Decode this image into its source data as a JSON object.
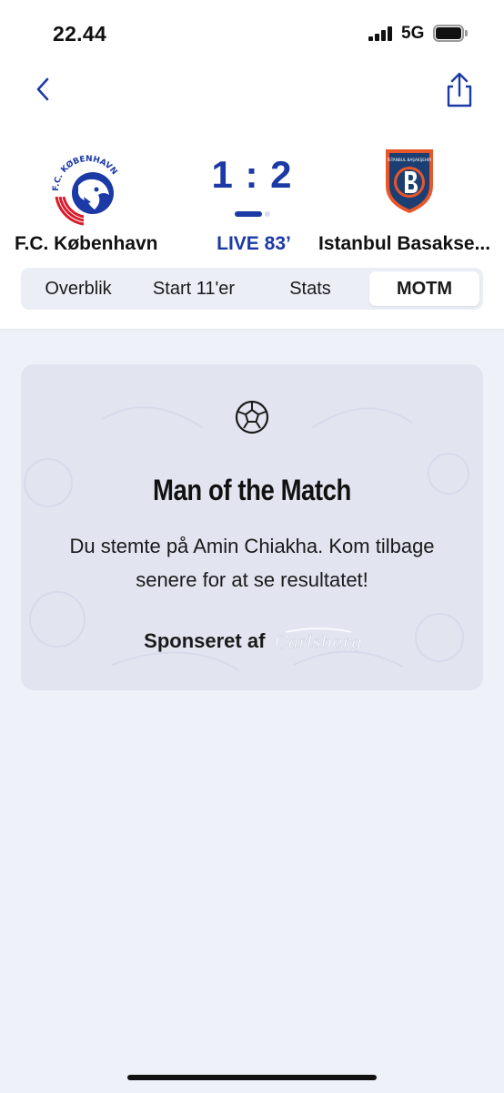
{
  "status_bar": {
    "time": "22.44",
    "network": "5G"
  },
  "nav": {
    "back_icon": "chevron-left-icon",
    "share_icon": "share-icon"
  },
  "match": {
    "home_team": "F.C. København",
    "away_team": "Istanbul Basakse...",
    "score": "1 : 2",
    "status": "LIVE 83’",
    "home_logo_text": "F.C. KØBENHAVN",
    "away_logo_text": "İSTANBUL BAŞAKŞEHİR"
  },
  "tabs": [
    {
      "label": "Overblik",
      "active": false
    },
    {
      "label": "Start 11'er",
      "active": false
    },
    {
      "label": "Stats",
      "active": false
    },
    {
      "label": "MOTM",
      "active": true
    }
  ],
  "motm_card": {
    "icon": "football-icon",
    "title": "Man of the Match",
    "message": "Du stemte på Amin Chiakha. Kom tilbage senere for at se resultatet!",
    "sponsor_label": "Sponseret af",
    "sponsor_logo_text": "Carlsberg"
  },
  "colors": {
    "accent": "#1b3aa6",
    "page_bg": "#eff1f9",
    "card_bg": "#e2e5f0"
  }
}
